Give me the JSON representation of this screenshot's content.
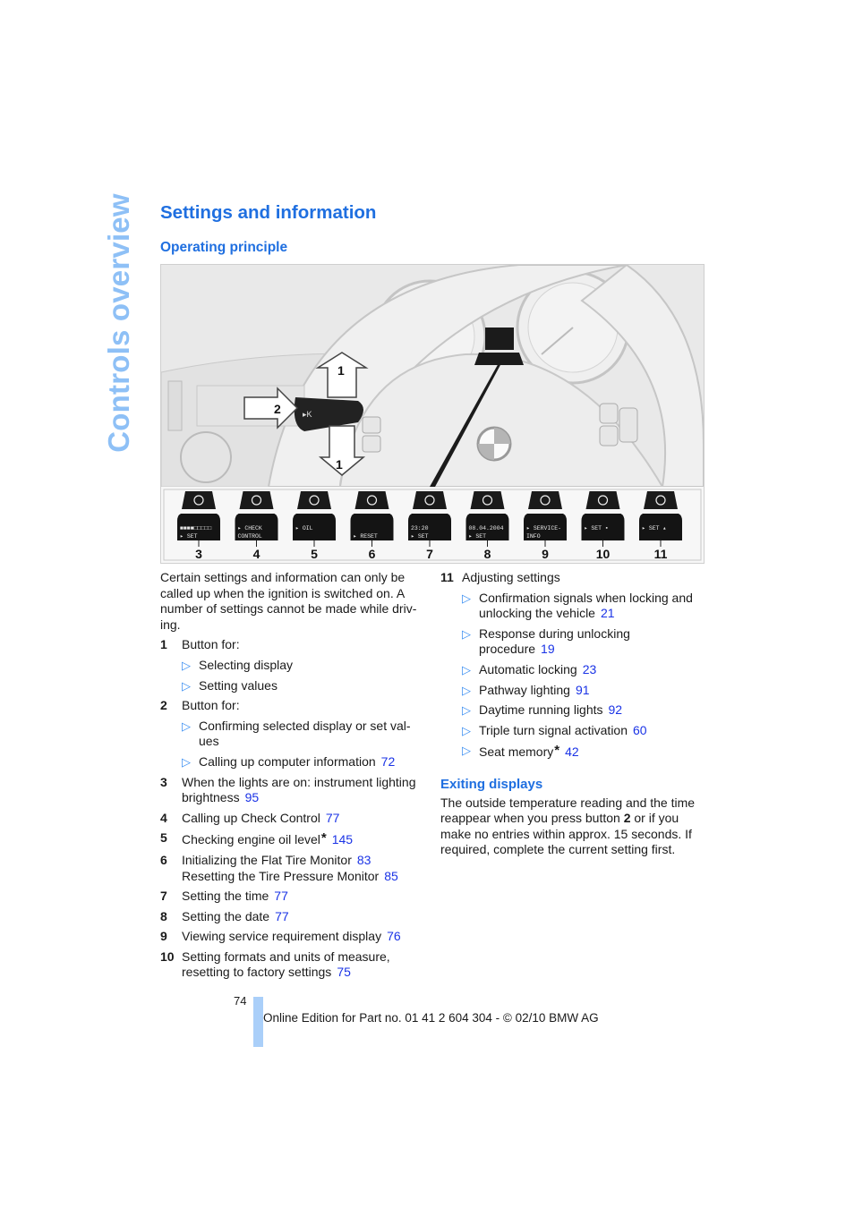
{
  "side_tab": "Controls overview",
  "title": "Settings and information",
  "subtitle": "Operating principle",
  "figure": {
    "callouts": {
      "button1": "1",
      "button2": "2"
    },
    "displays": [
      {
        "num": "3",
        "icon": "brightness-icon",
        "line1": "■■■■□□□□□",
        "line2": "▸ SET"
      },
      {
        "num": "4",
        "icon": "car-icon",
        "line1": "▸ CHECK",
        "line2": "CONTROL"
      },
      {
        "num": "5",
        "icon": "oil-can-icon",
        "line1": "▸    OIL",
        "line2": ""
      },
      {
        "num": "6",
        "icon": "tire-pressure-icon",
        "line1": "",
        "line2": "▸  RESET"
      },
      {
        "num": "7",
        "icon": "clock-icon",
        "line1": "23:20",
        "line2": "▸ SET"
      },
      {
        "num": "8",
        "icon": "calendar-icon",
        "line1": "08.04.2004",
        "line2": "▸ SET"
      },
      {
        "num": "9",
        "icon": "service-car-icon",
        "line1": "▸ SERVICE-",
        "line2": "INFO"
      },
      {
        "num": "10",
        "icon": "key-units-icon",
        "line1": "▸ SET  ▪",
        "line2": ""
      },
      {
        "num": "11",
        "icon": "key-settings-icon",
        "line1": "▸ SET  ▴",
        "line2": ""
      }
    ]
  },
  "intro": "Certain settings and information can only be called up when the ignition is switched on. A number of settings cannot be made while driv-ing.",
  "left_items": [
    {
      "num": "1",
      "text": "Button for:",
      "bullets": [
        {
          "text": "Selecting display",
          "ref": ""
        },
        {
          "text": "Setting values",
          "ref": ""
        }
      ]
    },
    {
      "num": "2",
      "text": "Button for:",
      "bullets": [
        {
          "text": "Confirming selected display or set val-ues",
          "ref": ""
        },
        {
          "text": "Calling up computer information",
          "ref": "72"
        }
      ]
    },
    {
      "num": "3",
      "text": "When the lights are on: instrument lighting brightness",
      "ref": "95"
    },
    {
      "num": "4",
      "text": "Calling up Check Control",
      "ref": "77"
    },
    {
      "num": "5",
      "text": "Checking engine oil level",
      "star": "*",
      "ref": "145"
    },
    {
      "num": "6",
      "text": "Initializing the Flat Tire Monitor",
      "ref": "83",
      "text2": "Resetting the Tire Pressure Monitor",
      "ref2": "85"
    },
    {
      "num": "7",
      "text": "Setting the time",
      "ref": "77"
    },
    {
      "num": "8",
      "text": "Setting the date",
      "ref": "77"
    },
    {
      "num": "9",
      "text": "Viewing service requirement display",
      "ref": "76"
    },
    {
      "num": "10",
      "text": "Setting formats and units of measure, resetting to factory settings",
      "ref": "75"
    }
  ],
  "right_item": {
    "num": "11",
    "text": "Adjusting settings",
    "bullets": [
      {
        "text": "Confirmation signals when locking and unlocking the vehicle",
        "ref": "21"
      },
      {
        "text": "Response during unlocking procedure",
        "ref": "19"
      },
      {
        "text": "Automatic locking",
        "ref": "23"
      },
      {
        "text": "Pathway lighting",
        "ref": "91"
      },
      {
        "text": "Daytime running lights",
        "ref": "92"
      },
      {
        "text": "Triple turn signal activation",
        "ref": "60"
      },
      {
        "text": "Seat memory",
        "star": "*",
        "ref": "42"
      }
    ]
  },
  "exiting": {
    "heading": "Exiting displays",
    "pre": "The outside temperature reading and the time reappear when you press button ",
    "bold": "2",
    "post": " or if you make no entries within approx. 15 seconds. If required, complete the current setting first."
  },
  "footer": {
    "page_number": "74",
    "text": "Online Edition for Part no. 01 41 2 604 304 - © 02/10 BMW AG"
  },
  "colors": {
    "heading": "#1f6fe0",
    "side_tab": "#8ec0f6",
    "link": "#1a33e6",
    "footer_bar": "#aacff9"
  }
}
